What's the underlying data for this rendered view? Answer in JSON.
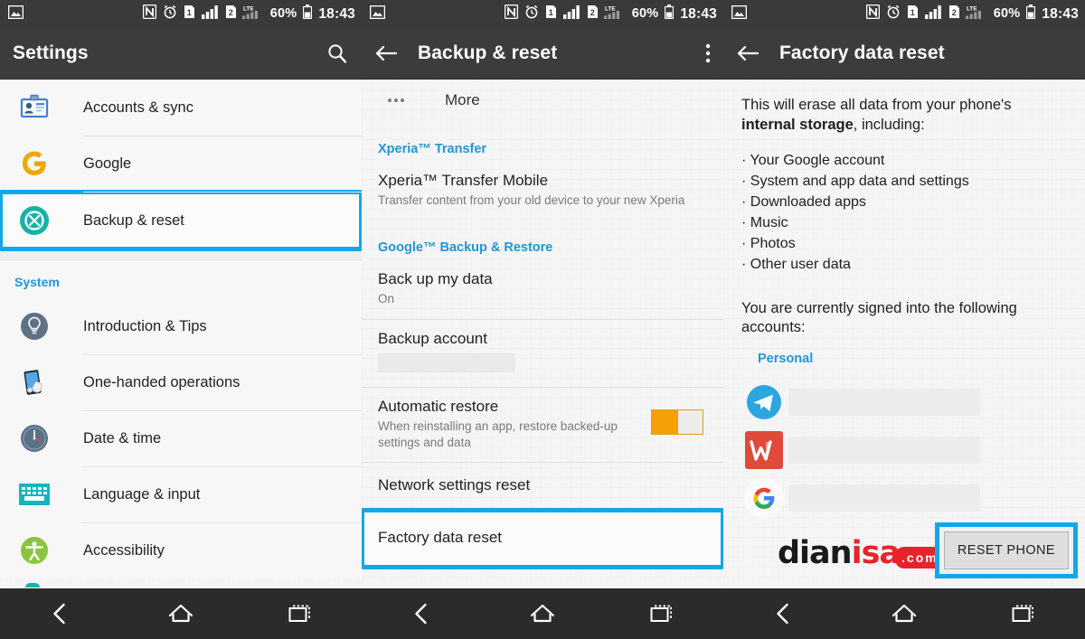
{
  "status_bar": {
    "image_icon": "image-icon",
    "nfc_icon": "nfc-icon",
    "alarm_icon": "alarm-icon",
    "sim1_label": "1",
    "sim2_label": "2",
    "lte_label": "LTE",
    "battery_percent": "60%",
    "time": "18:43"
  },
  "colors": {
    "highlight": "#14a7e8",
    "accent_blue": "#2196d6",
    "toggle_on": "#f5a005",
    "appbar": "#3c3c3c",
    "statusbar": "#3a3a3a"
  },
  "panel_settings": {
    "title": "Settings",
    "search_icon": "search-icon",
    "items": [
      {
        "label": "Accounts & sync",
        "icon": "accounts-sync-icon",
        "highlighted": false
      },
      {
        "label": "Google",
        "icon": "google-icon",
        "highlighted": false
      },
      {
        "label": "Backup & reset",
        "icon": "backup-reset-icon",
        "highlighted": true
      }
    ],
    "section_label": "System",
    "system_items": [
      {
        "label": "Introduction & Tips",
        "icon": "lightbulb-icon"
      },
      {
        "label": "One-handed operations",
        "icon": "one-handed-phone-icon"
      },
      {
        "label": "Date & time",
        "icon": "clock-icon"
      },
      {
        "label": "Language & input",
        "icon": "keyboard-icon"
      },
      {
        "label": "Accessibility",
        "icon": "accessibility-icon"
      }
    ]
  },
  "panel_backup": {
    "title": "Backup & reset",
    "back_icon": "back-arrow-icon",
    "overflow_icon": "overflow-menu-icon",
    "more_label": "More",
    "more_icon": "more-dots-icon",
    "category_transfer": "Xperia™ Transfer",
    "transfer_item": {
      "title": "Xperia™ Transfer Mobile",
      "subtitle": "Transfer content from your old device to your new Xperia"
    },
    "category_google": "Google™ Backup & Restore",
    "rows": [
      {
        "title": "Back up my data",
        "subtitle": "On",
        "type": "text"
      },
      {
        "title": "Backup account",
        "subtitle": "",
        "type": "redacted"
      },
      {
        "title": "Automatic restore",
        "subtitle": "When reinstalling an app, restore backed-up settings and data",
        "type": "toggle",
        "toggle_state": "on"
      },
      {
        "title": "Network settings reset",
        "subtitle": "",
        "type": "plain"
      },
      {
        "title": "Factory data reset",
        "subtitle": "",
        "type": "plain",
        "highlighted": true
      }
    ]
  },
  "panel_factory": {
    "title": "Factory data reset",
    "back_icon": "back-arrow-icon",
    "warning_prefix": "This will erase all data from your phone's ",
    "warning_bold": "internal storage",
    "warning_suffix": ", including:",
    "bullets": [
      "· Your Google account",
      "· System and app data and settings",
      "· Downloaded apps",
      "· Music",
      "· Photos",
      "· Other user data"
    ],
    "signed_in_text": "You are currently signed into the following accounts:",
    "accounts_category": "Personal",
    "accounts": [
      {
        "icon": "telegram-icon",
        "name_redacted": true
      },
      {
        "icon": "wps-office-icon",
        "name_redacted": true
      },
      {
        "icon": "google-icon",
        "name_redacted": true
      }
    ],
    "reset_button_label": "RESET PHONE"
  },
  "watermark": {
    "text_dark": "d",
    "text_mid": "ianisa",
    "text_part1": "dian",
    "text_part2": "isa",
    "com_badge": ".com"
  },
  "nav_bar": {
    "back_icon": "nav-back-icon",
    "home_icon": "nav-home-icon",
    "recents_icon": "nav-recents-icon"
  }
}
